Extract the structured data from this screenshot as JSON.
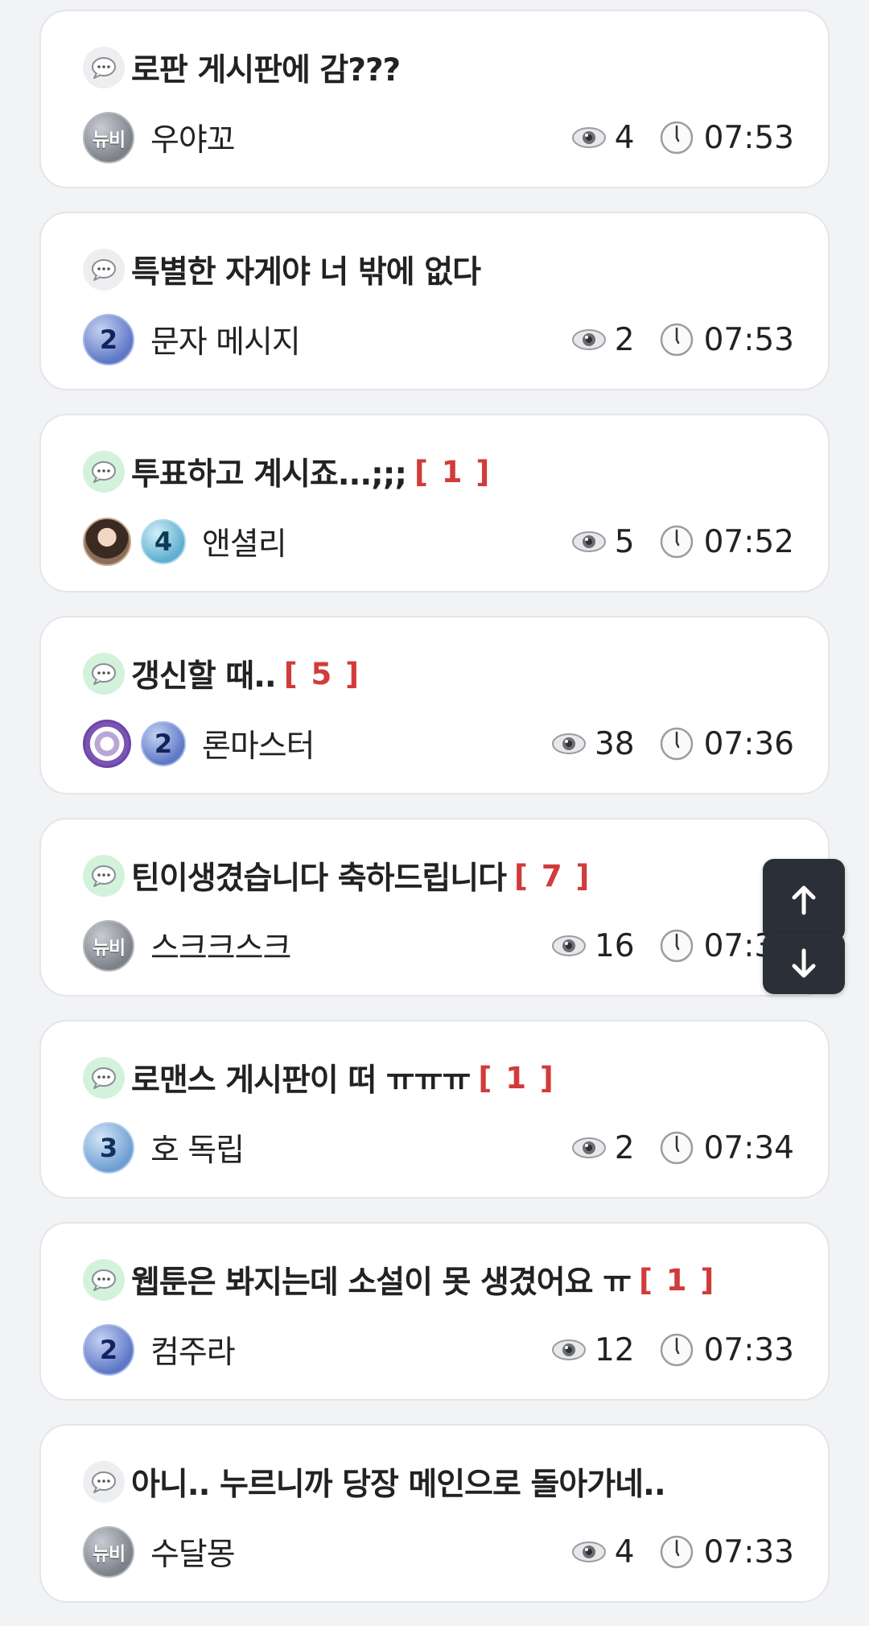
{
  "posts": [
    {
      "title": "로판 게시판에 감???",
      "comments": "",
      "author": "우야꼬",
      "badge": "뉴비",
      "badge_type": "newbie",
      "avatar": "",
      "views": "4",
      "time": "07:53",
      "bubble": "gray"
    },
    {
      "title": "특별한 자게야 너 밖에 없다",
      "comments": "",
      "author": "문자 메시지",
      "badge": "2",
      "badge_type": "l2",
      "avatar": "",
      "views": "2",
      "time": "07:53",
      "bubble": "gray"
    },
    {
      "title": "투표하고 계시죠...;;;",
      "comments": "[ 1 ]",
      "author": "앤셜리",
      "badge": "4",
      "badge_type": "l4",
      "avatar": "photo",
      "views": "5",
      "time": "07:52",
      "bubble": "green"
    },
    {
      "title": "갱신할 때..",
      "comments": "[ 5 ]",
      "author": "론마스터",
      "badge": "2",
      "badge_type": "l2",
      "avatar": "emblem",
      "views": "38",
      "time": "07:36",
      "bubble": "green"
    },
    {
      "title": "틴이생겼습니다 축하드립니다",
      "comments": "[ 7 ]",
      "author": "스크크스크",
      "badge": "뉴비",
      "badge_type": "newbie",
      "avatar": "",
      "views": "16",
      "time": "07:35",
      "bubble": "green"
    },
    {
      "title": "로맨스 게시판이 떠 ㅠㅠㅠ",
      "comments": "[ 1 ]",
      "author": "호 독립",
      "badge": "3",
      "badge_type": "l3",
      "avatar": "",
      "views": "2",
      "time": "07:34",
      "bubble": "green"
    },
    {
      "title": "웹툰은 봐지는데 소설이 못 생겼어요 ㅠ",
      "comments": "[ 1 ]",
      "author": "컴주라",
      "badge": "2",
      "badge_type": "l2",
      "avatar": "",
      "views": "12",
      "time": "07:33",
      "bubble": "green"
    },
    {
      "title": "아니.. 누르니까 당장 메인으로 돌아가네..",
      "comments": "",
      "author": "수달몽",
      "badge": "뉴비",
      "badge_type": "newbie",
      "avatar": "",
      "views": "4",
      "time": "07:33",
      "bubble": "gray"
    }
  ],
  "scroll_buttons": {
    "up_icon": "arrow-up-icon",
    "down_icon": "arrow-down-icon"
  },
  "colors": {
    "comment_count": "#d23b3b",
    "card_border": "#e3e5ea",
    "scroll_button_bg": "#2b2f38",
    "background": "#f2f3f5"
  }
}
